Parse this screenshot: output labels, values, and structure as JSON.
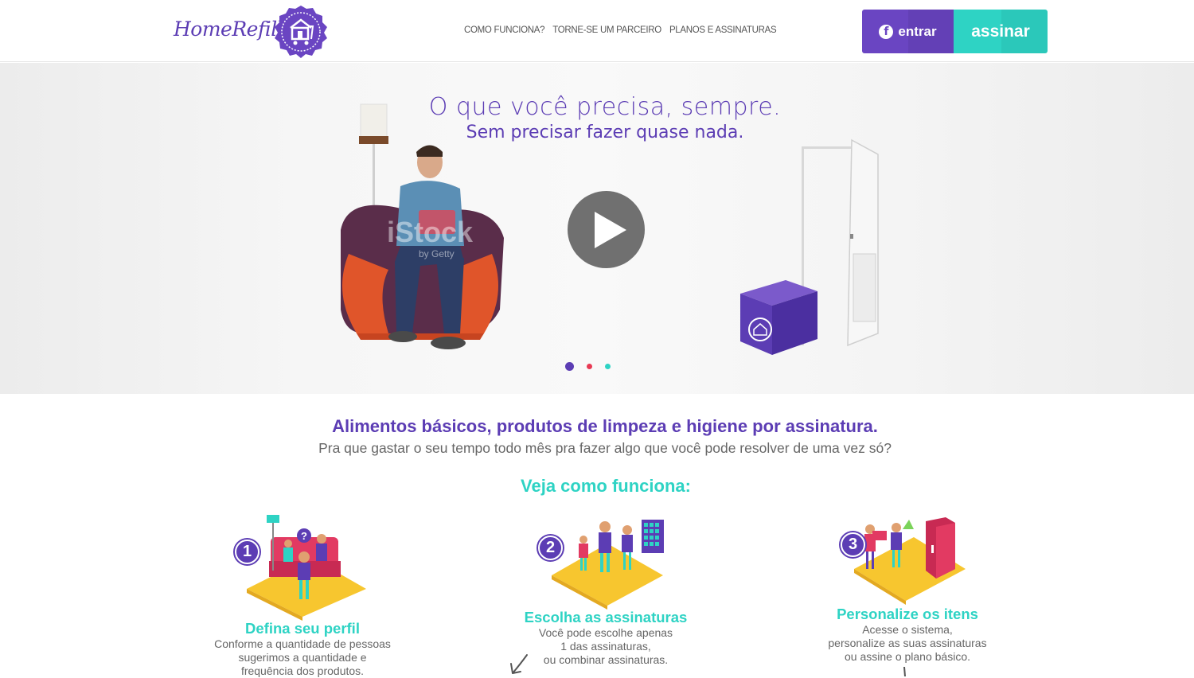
{
  "brand": {
    "name": "HomeRefill",
    "color": "#5c3db4",
    "accent": "#2ed3c4"
  },
  "nav": {
    "items": [
      {
        "label": "COMO FUNCIONA?"
      },
      {
        "label": "TORNE-SE UM PARCEIRO"
      },
      {
        "label": "PLANOS E ASSINATURAS"
      }
    ]
  },
  "auth": {
    "login_label": "entrar",
    "login_icon": "facebook-icon",
    "subscribe_label": "assinar"
  },
  "hero": {
    "title": "O que você precisa, sempre.",
    "subtitle": "Sem precisar fazer quase nada.",
    "watermark": "iStock",
    "watermark_sub": "by Getty",
    "carousel_dots": [
      "#5c3db4",
      "#e83a54",
      "#2ed3c4"
    ],
    "active_slide": 1
  },
  "intro": {
    "title": "Alimentos básicos, produtos de limpeza e higiene por assinatura.",
    "subtitle": "Pra que gastar o seu tempo todo mês pra fazer algo que você pode resolver de uma vez só?"
  },
  "how": {
    "title": "Veja como funciona:",
    "steps": [
      {
        "number": "1",
        "title": "Defina seu perfil",
        "lines": [
          "Conforme a quantidade de pessoas",
          "sugerimos a quantidade e",
          "frequência dos produtos."
        ]
      },
      {
        "number": "2",
        "title": "Escolha as assinaturas",
        "lines": [
          "Você pode escolhe apenas",
          "1 das assinaturas,",
          "ou combinar assinaturas."
        ]
      },
      {
        "number": "3",
        "title": "Personalize os itens",
        "lines": [
          "Acesse o sistema,",
          "personalize as suas assinaturas",
          "ou assine o plano básico."
        ]
      }
    ]
  }
}
